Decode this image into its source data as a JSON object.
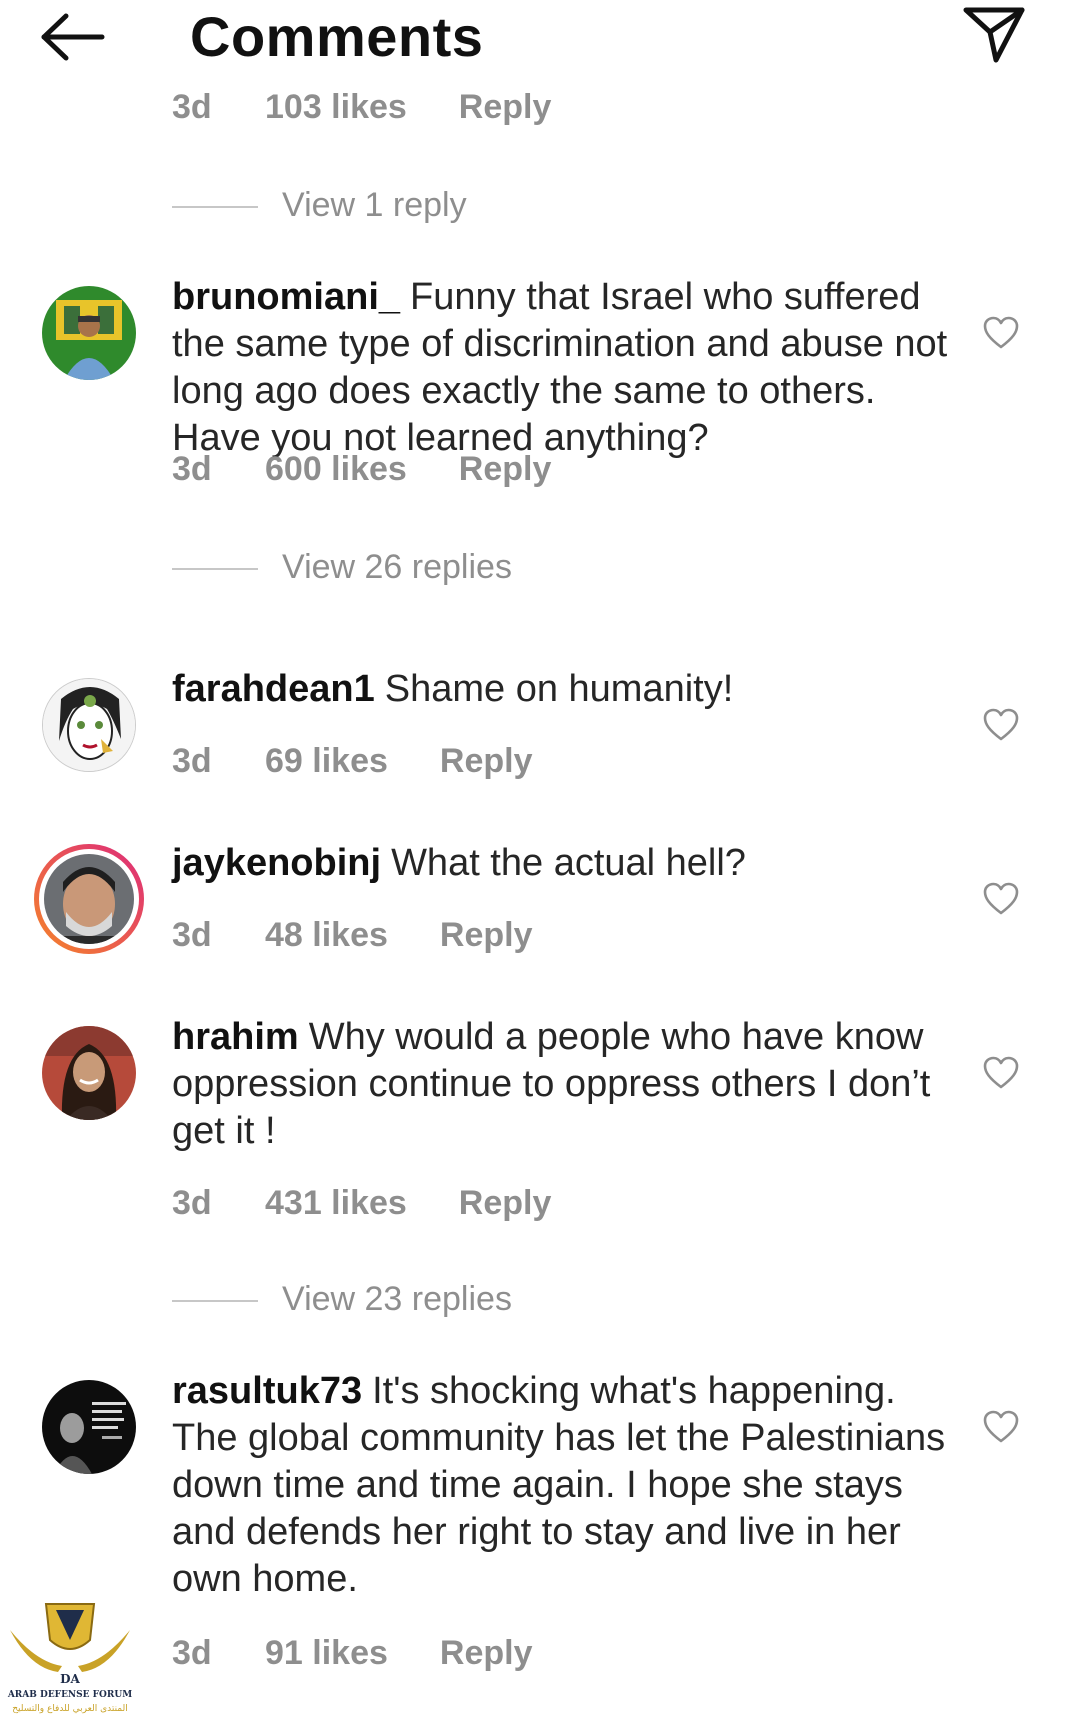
{
  "header": {
    "title": "Comments",
    "back_icon": "arrow-left-icon",
    "send_icon": "paper-plane-icon"
  },
  "top_meta": {
    "time": "3d",
    "likes": "103 likes",
    "reply": "Reply"
  },
  "top_view_replies": "View 1 reply",
  "comments": [
    {
      "username": "brunomiani_",
      "text": "Funny that Israel who suffered the same type of discrimination and abuse not long ago does exactly the same to others. Have you not learned anything?",
      "time": "3d",
      "likes": "600 likes",
      "reply": "Reply",
      "view_replies": "View 26 replies"
    },
    {
      "username": "farahdean1",
      "text": "Shame on humanity!",
      "time": "3d",
      "likes": "69 likes",
      "reply": "Reply"
    },
    {
      "username": "jaykenobinj",
      "text": "What the actual hell?",
      "time": "3d",
      "likes": "48 likes",
      "reply": "Reply"
    },
    {
      "username": "hrahim",
      "text": "Why would a people who have know oppression continue to oppress others I don’t get it !",
      "time": "3d",
      "likes": "431 likes",
      "reply": "Reply",
      "view_replies": "View 23 replies"
    },
    {
      "username": "rasultuk73",
      "text": "It's shocking what's happening. The global community has let the Palestinians down time and time again. I hope she stays and defends her right to stay and live in her own home.",
      "time": "3d",
      "likes": "91 likes",
      "reply": "Reply"
    }
  ],
  "watermark": {
    "initials": "DA",
    "name": "ARAB DEFENSE FORUM",
    "arabic": "المنتدى العربي للدفاع والتسليح"
  },
  "colors": {
    "text": "#262626",
    "meta": "#8e8e8e",
    "story_ring_start": "#f58529",
    "story_ring_end": "#dd2a7b"
  }
}
